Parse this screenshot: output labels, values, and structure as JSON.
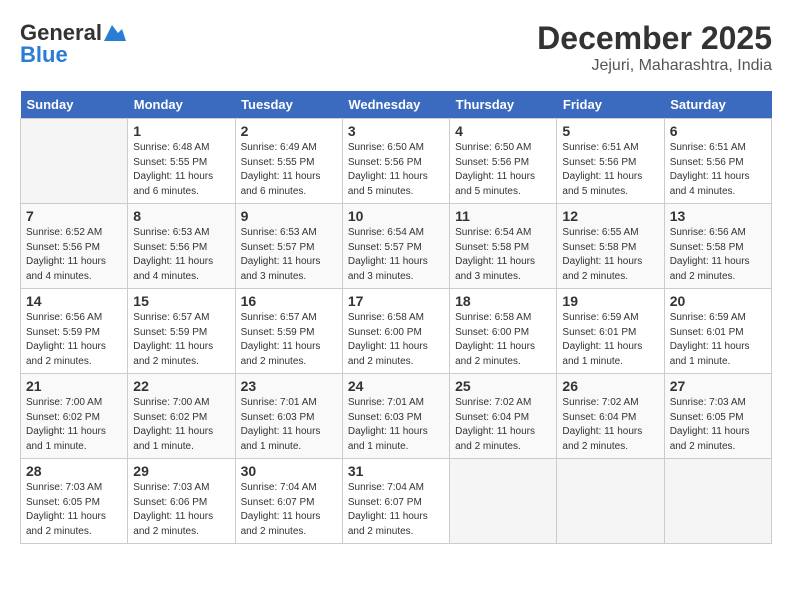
{
  "header": {
    "logo_line1": "General",
    "logo_line2": "Blue",
    "month_year": "December 2025",
    "location": "Jejuri, Maharashtra, India"
  },
  "days_of_week": [
    "Sunday",
    "Monday",
    "Tuesday",
    "Wednesday",
    "Thursday",
    "Friday",
    "Saturday"
  ],
  "weeks": [
    [
      {
        "date": "",
        "info": ""
      },
      {
        "date": "1",
        "info": "Sunrise: 6:48 AM\nSunset: 5:55 PM\nDaylight: 11 hours\nand 6 minutes."
      },
      {
        "date": "2",
        "info": "Sunrise: 6:49 AM\nSunset: 5:55 PM\nDaylight: 11 hours\nand 6 minutes."
      },
      {
        "date": "3",
        "info": "Sunrise: 6:50 AM\nSunset: 5:56 PM\nDaylight: 11 hours\nand 5 minutes."
      },
      {
        "date": "4",
        "info": "Sunrise: 6:50 AM\nSunset: 5:56 PM\nDaylight: 11 hours\nand 5 minutes."
      },
      {
        "date": "5",
        "info": "Sunrise: 6:51 AM\nSunset: 5:56 PM\nDaylight: 11 hours\nand 5 minutes."
      },
      {
        "date": "6",
        "info": "Sunrise: 6:51 AM\nSunset: 5:56 PM\nDaylight: 11 hours\nand 4 minutes."
      }
    ],
    [
      {
        "date": "7",
        "info": "Sunrise: 6:52 AM\nSunset: 5:56 PM\nDaylight: 11 hours\nand 4 minutes."
      },
      {
        "date": "8",
        "info": "Sunrise: 6:53 AM\nSunset: 5:56 PM\nDaylight: 11 hours\nand 4 minutes."
      },
      {
        "date": "9",
        "info": "Sunrise: 6:53 AM\nSunset: 5:57 PM\nDaylight: 11 hours\nand 3 minutes."
      },
      {
        "date": "10",
        "info": "Sunrise: 6:54 AM\nSunset: 5:57 PM\nDaylight: 11 hours\nand 3 minutes."
      },
      {
        "date": "11",
        "info": "Sunrise: 6:54 AM\nSunset: 5:58 PM\nDaylight: 11 hours\nand 3 minutes."
      },
      {
        "date": "12",
        "info": "Sunrise: 6:55 AM\nSunset: 5:58 PM\nDaylight: 11 hours\nand 2 minutes."
      },
      {
        "date": "13",
        "info": "Sunrise: 6:56 AM\nSunset: 5:58 PM\nDaylight: 11 hours\nand 2 minutes."
      }
    ],
    [
      {
        "date": "14",
        "info": "Sunrise: 6:56 AM\nSunset: 5:59 PM\nDaylight: 11 hours\nand 2 minutes."
      },
      {
        "date": "15",
        "info": "Sunrise: 6:57 AM\nSunset: 5:59 PM\nDaylight: 11 hours\nand 2 minutes."
      },
      {
        "date": "16",
        "info": "Sunrise: 6:57 AM\nSunset: 5:59 PM\nDaylight: 11 hours\nand 2 minutes."
      },
      {
        "date": "17",
        "info": "Sunrise: 6:58 AM\nSunset: 6:00 PM\nDaylight: 11 hours\nand 2 minutes."
      },
      {
        "date": "18",
        "info": "Sunrise: 6:58 AM\nSunset: 6:00 PM\nDaylight: 11 hours\nand 2 minutes."
      },
      {
        "date": "19",
        "info": "Sunrise: 6:59 AM\nSunset: 6:01 PM\nDaylight: 11 hours\nand 1 minute."
      },
      {
        "date": "20",
        "info": "Sunrise: 6:59 AM\nSunset: 6:01 PM\nDaylight: 11 hours\nand 1 minute."
      }
    ],
    [
      {
        "date": "21",
        "info": "Sunrise: 7:00 AM\nSunset: 6:02 PM\nDaylight: 11 hours\nand 1 minute."
      },
      {
        "date": "22",
        "info": "Sunrise: 7:00 AM\nSunset: 6:02 PM\nDaylight: 11 hours\nand 1 minute."
      },
      {
        "date": "23",
        "info": "Sunrise: 7:01 AM\nSunset: 6:03 PM\nDaylight: 11 hours\nand 1 minute."
      },
      {
        "date": "24",
        "info": "Sunrise: 7:01 AM\nSunset: 6:03 PM\nDaylight: 11 hours\nand 1 minute."
      },
      {
        "date": "25",
        "info": "Sunrise: 7:02 AM\nSunset: 6:04 PM\nDaylight: 11 hours\nand 2 minutes."
      },
      {
        "date": "26",
        "info": "Sunrise: 7:02 AM\nSunset: 6:04 PM\nDaylight: 11 hours\nand 2 minutes."
      },
      {
        "date": "27",
        "info": "Sunrise: 7:03 AM\nSunset: 6:05 PM\nDaylight: 11 hours\nand 2 minutes."
      }
    ],
    [
      {
        "date": "28",
        "info": "Sunrise: 7:03 AM\nSunset: 6:05 PM\nDaylight: 11 hours\nand 2 minutes."
      },
      {
        "date": "29",
        "info": "Sunrise: 7:03 AM\nSunset: 6:06 PM\nDaylight: 11 hours\nand 2 minutes."
      },
      {
        "date": "30",
        "info": "Sunrise: 7:04 AM\nSunset: 6:07 PM\nDaylight: 11 hours\nand 2 minutes."
      },
      {
        "date": "31",
        "info": "Sunrise: 7:04 AM\nSunset: 6:07 PM\nDaylight: 11 hours\nand 2 minutes."
      },
      {
        "date": "",
        "info": ""
      },
      {
        "date": "",
        "info": ""
      },
      {
        "date": "",
        "info": ""
      }
    ]
  ]
}
